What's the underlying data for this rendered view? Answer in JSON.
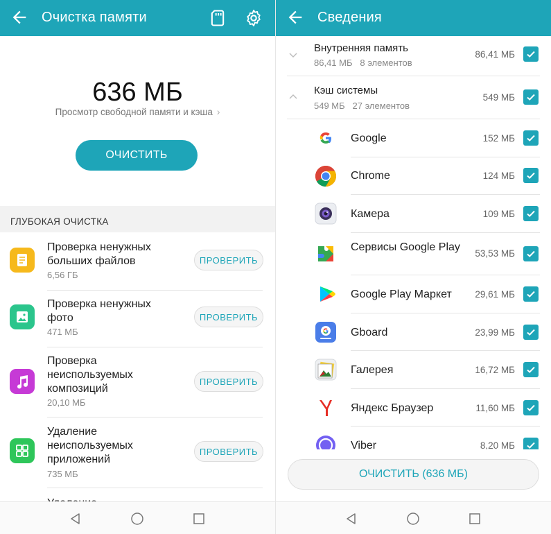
{
  "left": {
    "title": "Очистка памяти",
    "hero_size": "636 МБ",
    "hero_sub": "Просмотр свободной памяти и кэша",
    "clean_label": "ОЧИСТИТЬ",
    "section_title": "ГЛУБОКАЯ ОЧИСТКА",
    "items": [
      {
        "title": "Проверка ненужных больших файлов",
        "size": "6,56 ГБ",
        "button": "ПРОВЕРИТЬ",
        "icon": "document-icon",
        "color": "#f6b91c"
      },
      {
        "title": "Проверка ненужных фото",
        "size": "471 МБ",
        "button": "ПРОВЕРИТЬ",
        "icon": "photo-icon",
        "color": "#2bc58c"
      },
      {
        "title": "Проверка неиспользуемых композиций",
        "size": "20,10 МБ",
        "button": "ПРОВЕРИТЬ",
        "icon": "music-icon",
        "color": "#c63ad6"
      },
      {
        "title": "Удаление неиспользуемых приложений",
        "size": "735 МБ",
        "button": "ПРОВЕРИТЬ",
        "icon": "apps-icon",
        "color": "#2ec65a"
      }
    ],
    "partial_item": "Удаление"
  },
  "right": {
    "title": "Сведения",
    "groups": [
      {
        "name": "Внутренняя память",
        "meta_size": "86,41 МБ",
        "meta_count": "8 элементов",
        "size": "86,41 МБ",
        "checked": true
      },
      {
        "name": "Кэш системы",
        "meta_size": "549 МБ",
        "meta_count": "27 элементов",
        "size": "549 МБ",
        "checked": true
      }
    ],
    "apps": [
      {
        "name": "Google",
        "size": "152 МБ",
        "icon": "google-icon"
      },
      {
        "name": "Chrome",
        "size": "124 МБ",
        "icon": "chrome-icon"
      },
      {
        "name": "Камера",
        "size": "109 МБ",
        "icon": "camera-icon"
      },
      {
        "name": "Сервисы Google Play",
        "size": "53,53 МБ",
        "icon": "play-services-icon"
      },
      {
        "name": "Google Play Маркет",
        "size": "29,61 МБ",
        "icon": "play-store-icon"
      },
      {
        "name": "Gboard",
        "size": "23,99 МБ",
        "icon": "gboard-icon"
      },
      {
        "name": "Галерея",
        "size": "16,72 МБ",
        "icon": "gallery-icon"
      },
      {
        "name": "Яндекс Браузер",
        "size": "11,60 МБ",
        "icon": "yandex-browser-icon"
      },
      {
        "name": "Viber",
        "size": "8,20 МБ",
        "icon": "viber-icon"
      }
    ],
    "clean_label": "ОЧИСТИТЬ (636 МБ)"
  },
  "colors": {
    "accent": "#1ea5b8"
  }
}
